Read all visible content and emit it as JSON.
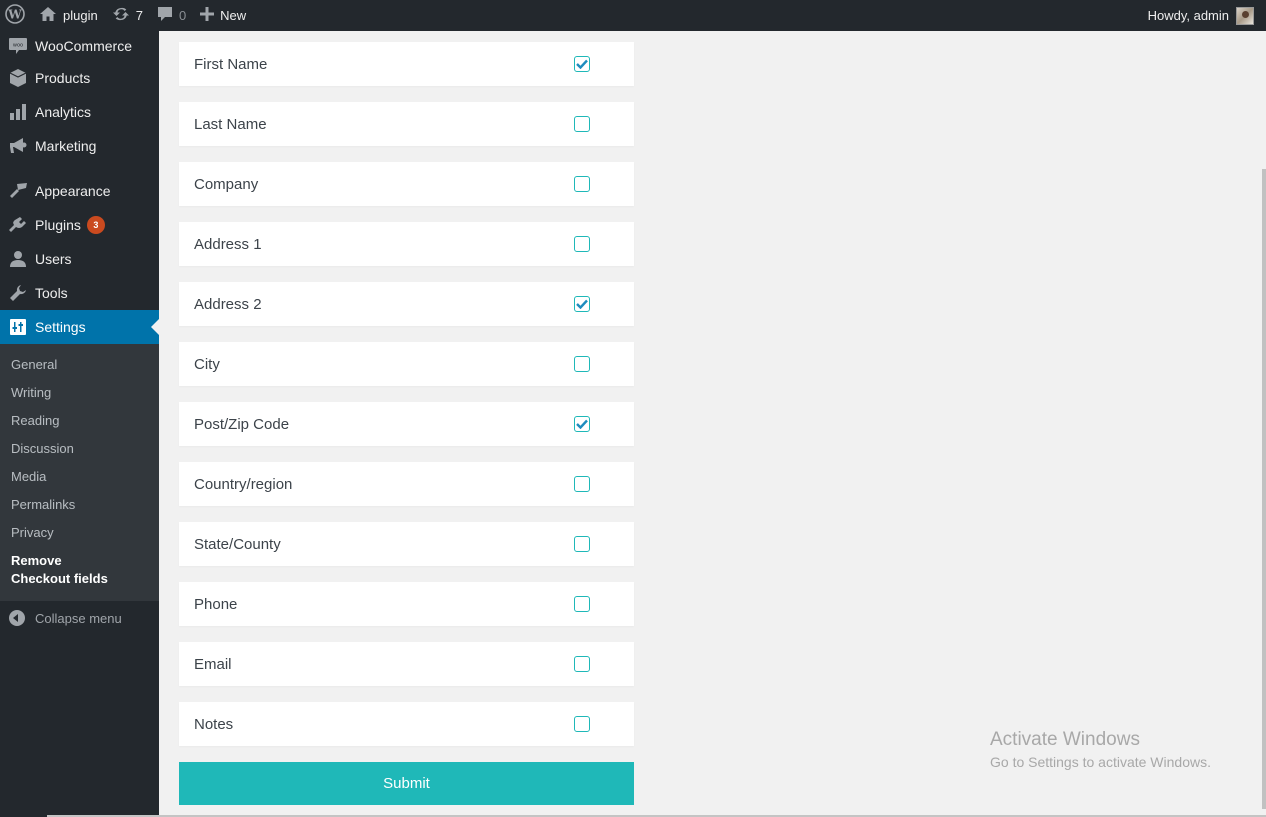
{
  "adminbar": {
    "site_name": "plugin",
    "updates_count": "7",
    "comments_count": "0",
    "new_label": "New",
    "greeting": "Howdy, admin"
  },
  "sidebar": {
    "items": [
      {
        "label": "WooCommerce",
        "icon": "woocommerce-icon"
      },
      {
        "label": "Products",
        "icon": "products-box-icon"
      },
      {
        "label": "Analytics",
        "icon": "bar-chart-icon"
      },
      {
        "label": "Marketing",
        "icon": "megaphone-icon"
      },
      {
        "label": "Appearance",
        "icon": "paintbrush-icon"
      },
      {
        "label": "Plugins",
        "icon": "plugin-icon",
        "badge": "3"
      },
      {
        "label": "Users",
        "icon": "user-icon"
      },
      {
        "label": "Tools",
        "icon": "wrench-icon"
      },
      {
        "label": "Settings",
        "icon": "settings-sliders-icon",
        "current": true
      }
    ],
    "submenu": [
      {
        "label": "General"
      },
      {
        "label": "Writing"
      },
      {
        "label": "Reading"
      },
      {
        "label": "Discussion"
      },
      {
        "label": "Media"
      },
      {
        "label": "Permalinks"
      },
      {
        "label": "Privacy"
      },
      {
        "label": "Remove Checkout fields",
        "current": true
      }
    ],
    "collapse_label": "Collapse menu"
  },
  "form": {
    "fields": [
      {
        "label": "First Name",
        "checked": true
      },
      {
        "label": "Last Name",
        "checked": false
      },
      {
        "label": "Company",
        "checked": false
      },
      {
        "label": "Address 1",
        "checked": false
      },
      {
        "label": "Address 2",
        "checked": true
      },
      {
        "label": "City",
        "checked": false
      },
      {
        "label": "Post/Zip Code",
        "checked": true
      },
      {
        "label": "Country/region",
        "checked": false
      },
      {
        "label": "State/County",
        "checked": false
      },
      {
        "label": "Phone",
        "checked": false
      },
      {
        "label": "Email",
        "checked": false
      },
      {
        "label": "Notes",
        "checked": false
      }
    ],
    "submit_label": "Submit"
  },
  "watermark": {
    "title": "Activate Windows",
    "subtitle": "Go to Settings to activate Windows."
  },
  "colors": {
    "accent": "#1fb8b8",
    "admin_bar": "#23282d",
    "menu_current": "#0073aa",
    "badge": "#ca4a1f"
  }
}
